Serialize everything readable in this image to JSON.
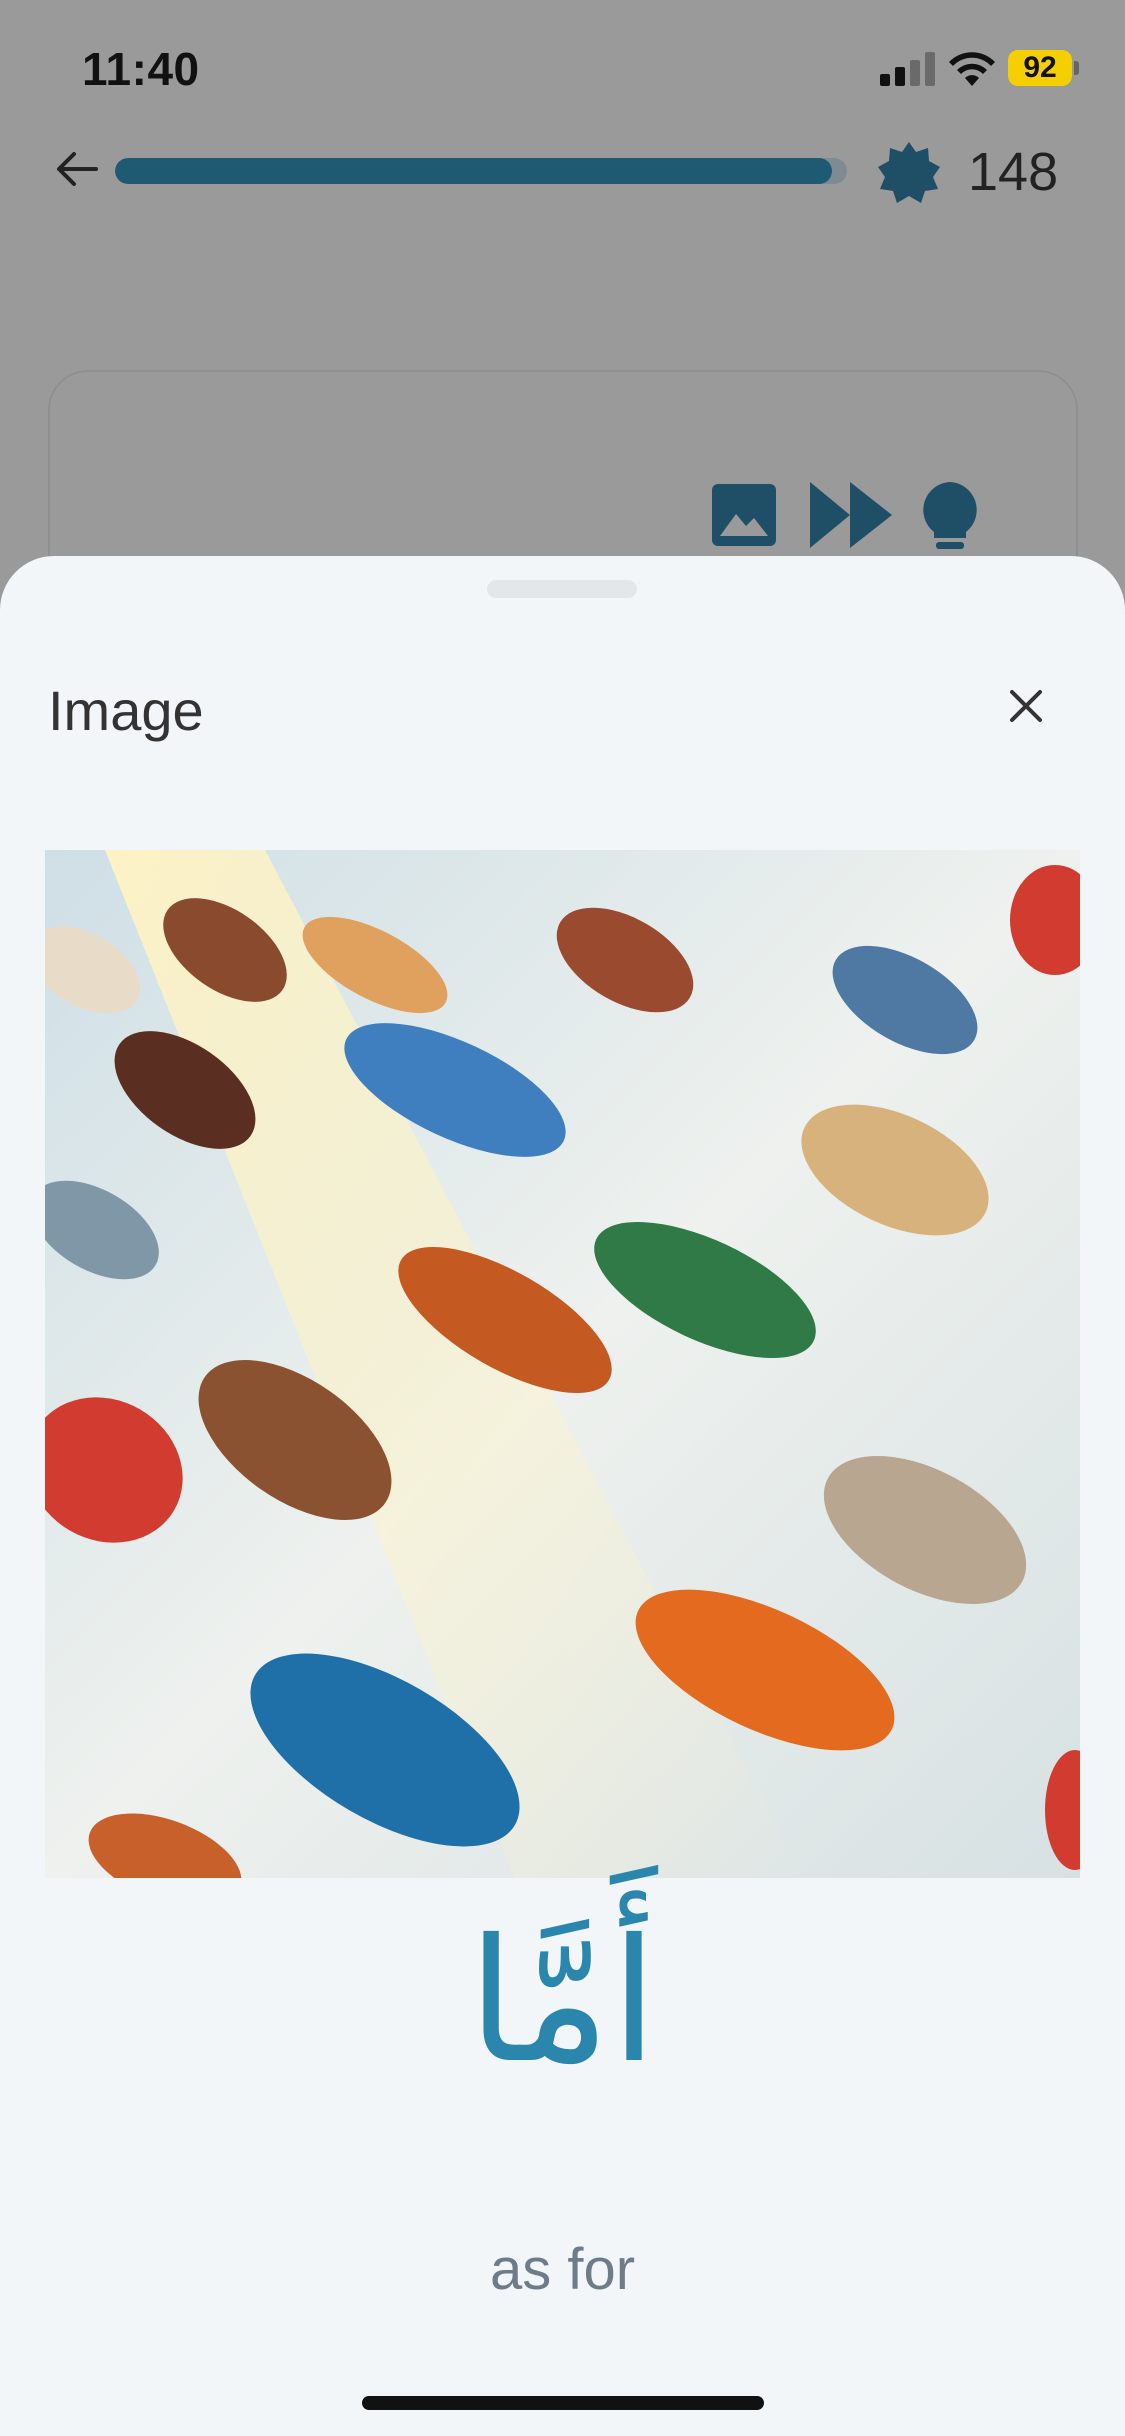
{
  "status_bar": {
    "time": "11:40",
    "battery": "92",
    "icons": [
      "signal-icon",
      "wifi-icon",
      "battery-icon"
    ]
  },
  "header": {
    "back_icon": "arrow-left-icon",
    "progress_fraction": 0.98,
    "badge_icon": "badge-icon",
    "points": "148"
  },
  "card": {
    "icons": [
      "image-icon",
      "fast-forward-icon",
      "lightbulb-icon"
    ],
    "icon_color": "#1f4f66"
  },
  "sheet": {
    "title": "Image",
    "close_icon": "close-icon",
    "image_icon": "shoes-photo",
    "word": "أَمَّا",
    "translation": "as for",
    "accent_color": "#2a86ad"
  }
}
